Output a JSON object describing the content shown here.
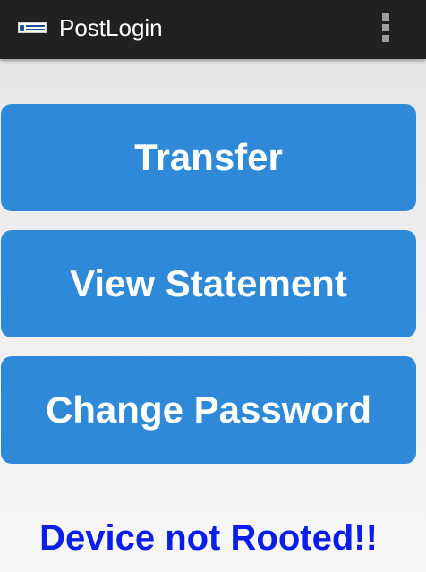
{
  "app_bar": {
    "title": "PostLogin",
    "logo_icon": "security-innovation-logo-icon",
    "menu_icon": "overflow-menu-icon",
    "background_color": "#212121",
    "title_color": "#ffffff"
  },
  "actions": {
    "transfer_label": "Transfer",
    "view_statement_label": "View Statement",
    "change_password_label": "Change Password",
    "button_color": "#2e8ad8",
    "button_text_color": "#ffffff"
  },
  "status": {
    "message": "Device not Rooted!!",
    "color": "#0b1ee8"
  }
}
